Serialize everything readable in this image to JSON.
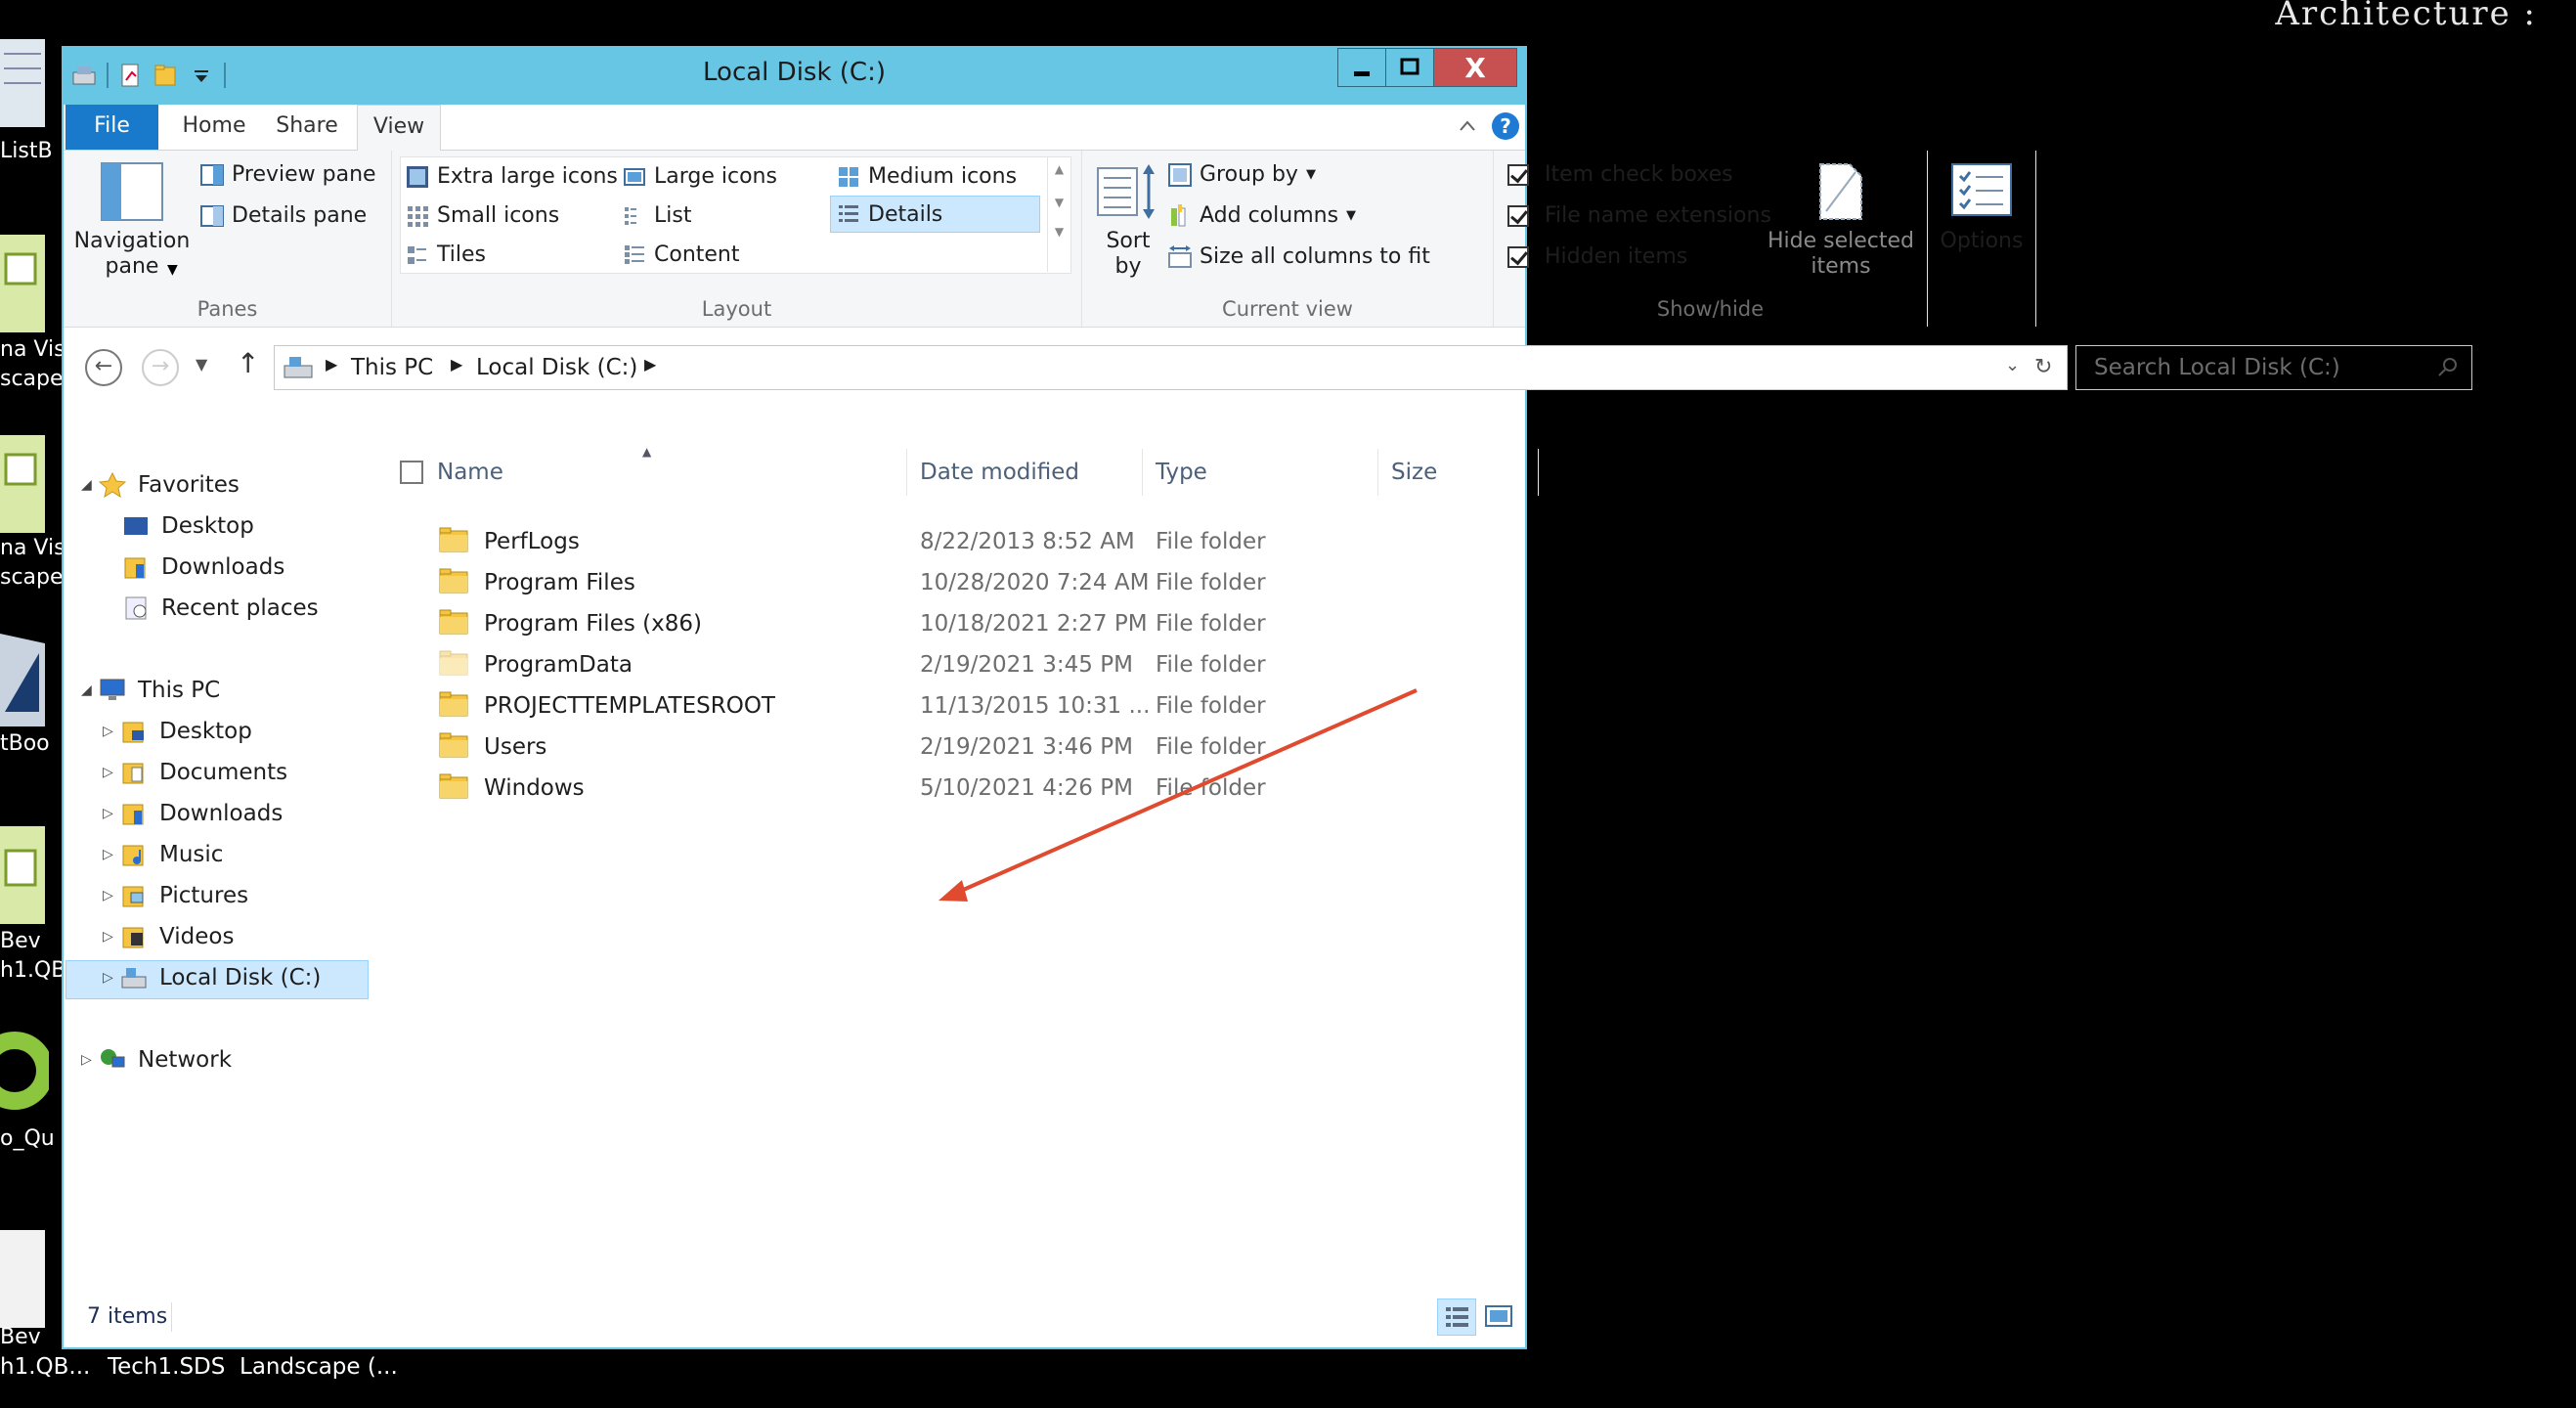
{
  "desktop": {
    "top_right_text": "Architecture  :",
    "left_labels": [
      "ListB",
      "na Vis",
      "scape",
      "na Vis",
      "scape",
      "tBoo",
      "Bev",
      "h1.QB",
      "o_Qu",
      "Bev",
      "h1.QB..."
    ],
    "bottom_labels": [
      "Tech1.SDS",
      "Landscape (..."
    ]
  },
  "window": {
    "title": "Local Disk (C:)",
    "controls": {
      "minimize": "▁",
      "maximize": "☐",
      "close": "X"
    }
  },
  "ribbon_tabs": [
    "File",
    "Home",
    "Share",
    "View"
  ],
  "ribbon": {
    "panes": {
      "label": "Panes",
      "navigation_pane": "Navigation pane",
      "preview_pane": "Preview pane",
      "details_pane": "Details pane"
    },
    "layout": {
      "label": "Layout",
      "items": [
        "Extra large icons",
        "Large icons",
        "Medium icons",
        "Small icons",
        "List",
        "Details",
        "Tiles",
        "Content"
      ],
      "selected": "Details"
    },
    "current_view": {
      "label": "Current view",
      "sort_by": "Sort by",
      "group_by": "Group by",
      "add_columns": "Add columns",
      "size_columns": "Size all columns to fit"
    },
    "show_hide": {
      "label": "Show/hide",
      "item_check_boxes": "Item check boxes",
      "file_name_extensions": "File name extensions",
      "hidden_items": "Hidden items",
      "hide_selected": "Hide selected items"
    },
    "options": "Options"
  },
  "address": {
    "crumbs": [
      "This PC",
      "Local Disk (C:)"
    ],
    "search_placeholder": "Search Local Disk (C:)"
  },
  "nav": {
    "favorites": "Favorites",
    "fav_items": [
      "Desktop",
      "Downloads",
      "Recent places"
    ],
    "this_pc": "This PC",
    "pc_items": [
      "Desktop",
      "Documents",
      "Downloads",
      "Music",
      "Pictures",
      "Videos",
      "Local Disk (C:)"
    ],
    "network": "Network"
  },
  "columns": [
    "Name",
    "Date modified",
    "Type",
    "Size"
  ],
  "files": [
    {
      "name": "PerfLogs",
      "date": "8/22/2013 8:52 AM",
      "type": "File folder",
      "hidden": false
    },
    {
      "name": "Program Files",
      "date": "10/28/2020 7:24 AM",
      "type": "File folder",
      "hidden": false
    },
    {
      "name": "Program Files (x86)",
      "date": "10/18/2021 2:27 PM",
      "type": "File folder",
      "hidden": false
    },
    {
      "name": "ProgramData",
      "date": "2/19/2021 3:45 PM",
      "type": "File folder",
      "hidden": true
    },
    {
      "name": "PROJECTTEMPLATESROOT",
      "date": "11/13/2015 10:31 ...",
      "type": "File folder",
      "hidden": false
    },
    {
      "name": "Users",
      "date": "2/19/2021 3:46 PM",
      "type": "File folder",
      "hidden": false
    },
    {
      "name": "Windows",
      "date": "5/10/2021 4:26 PM",
      "type": "File folder",
      "hidden": false
    }
  ],
  "status": {
    "item_count": "7 items"
  },
  "colors": {
    "titlebar": "#66c6e3",
    "file_tab": "#1979ca",
    "close": "#c75050",
    "annotation_arrow": "#e04a2f",
    "selection": "#cce8ff"
  }
}
